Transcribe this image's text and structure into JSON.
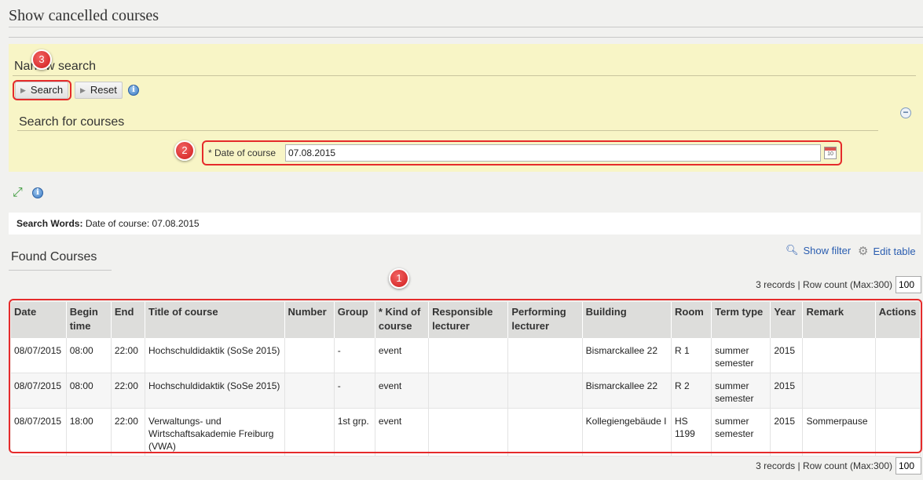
{
  "page_title": "Show cancelled courses",
  "narrow_search": {
    "heading": "Narrow search",
    "search_button": "Search",
    "reset_button": "Reset",
    "info_glyph": "i",
    "collapse_glyph": "−"
  },
  "search_for_courses": {
    "heading": "Search for courses",
    "date_label": "* Date of course",
    "date_value": "07.08.2015",
    "calendar_glyph": "10"
  },
  "search_words": {
    "label": "Search Words:",
    "value": "Date of course: 07.08.2015"
  },
  "found_courses": {
    "heading": "Found Courses",
    "show_filter": "Show filter",
    "edit_table": "Edit table",
    "records_text": "3 records | Row count (Max:300)",
    "row_count": "100"
  },
  "table": {
    "headers": [
      "Date",
      "Begin time",
      "End",
      "Title of course",
      "Number",
      "Group",
      "* Kind of course",
      "Responsible lecturer",
      "Performing lecturer",
      "Building",
      "Room",
      "Term type",
      "Year",
      "Remark",
      "Actions"
    ],
    "rows": [
      [
        "08/07/2015",
        "08:00",
        "22:00",
        "Hochschuldidaktik (SoSe 2015)",
        "",
        "-",
        "event",
        "",
        "",
        "Bismarckallee 22",
        "R 1",
        "summer semester",
        "2015",
        "",
        ""
      ],
      [
        "08/07/2015",
        "08:00",
        "22:00",
        "Hochschuldidaktik (SoSe 2015)",
        "",
        "-",
        "event",
        "",
        "",
        "Bismarckallee 22",
        "R 2",
        "summer semester",
        "2015",
        "",
        ""
      ],
      [
        "08/07/2015",
        "18:00",
        "22:00",
        "Verwaltungs- und Wirtschaftsakademie Freiburg (VWA)",
        "",
        "1st grp.",
        "event",
        "",
        "",
        "Kollegiengebäude I",
        "HS 1199",
        "summer semester",
        "2015",
        "Sommerpause",
        ""
      ]
    ]
  },
  "annotations": {
    "badge_1": "1",
    "badge_2": "2",
    "badge_3": "3",
    "highlight_color": "#e52b2b"
  },
  "icons": {
    "info": "info-icon",
    "collapse": "collapse-icon",
    "calendar": "calendar-icon",
    "expand": "expand-icon",
    "magnifier": "search-icon",
    "gear": "gear-icon"
  }
}
